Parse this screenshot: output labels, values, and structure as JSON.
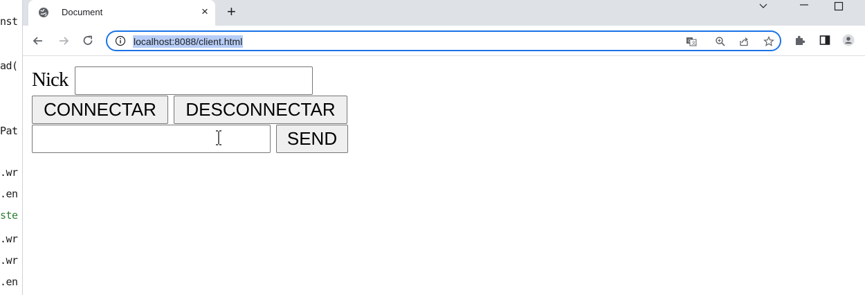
{
  "editor": {
    "lines": [
      "nst",
      "ad(",
      "Pat",
      ".wr",
      ".en",
      "ste",
      ".wr",
      ".wr",
      ".en"
    ]
  },
  "browser": {
    "tab": {
      "title": "Document",
      "close_glyph": "×"
    },
    "new_tab_glyph": "+",
    "window_controls": {
      "chevron": "⌄",
      "minimize": "–",
      "maximize": "☐"
    },
    "address": {
      "url": "localhost:8088/client.html"
    },
    "accent_color": "#1a73e8"
  },
  "page": {
    "nick_label": "Nick",
    "nick_value": "",
    "connect_label": "CONNECTAR",
    "disconnect_label": "DESCONNECTAR",
    "message_value": "",
    "send_label": "SEND"
  }
}
